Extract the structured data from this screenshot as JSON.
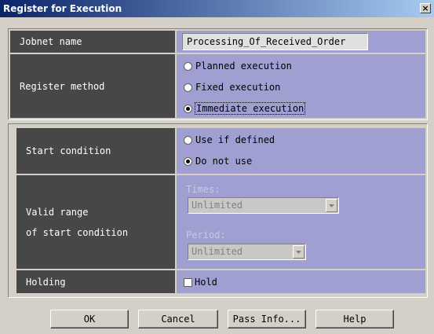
{
  "window": {
    "title": "Register for Execution",
    "close_glyph": "×"
  },
  "jobnet": {
    "label": "Jobnet name",
    "value": "Processing_Of_Received_Order"
  },
  "register_method": {
    "label": "Register method",
    "options": [
      "Planned execution",
      "Fixed execution",
      "Immediate execution"
    ],
    "selected": "Immediate execution"
  },
  "start_condition": {
    "label": "Start condition",
    "options": [
      "Use if defined",
      "Do not use"
    ],
    "selected": "Do not use"
  },
  "valid_range": {
    "label": "Valid range\nof start condition",
    "times_label": "Times:",
    "times_value": "Unlimited",
    "period_label": "Period:",
    "period_value": "Unlimited"
  },
  "holding": {
    "label": "Holding",
    "checkbox_label": "Hold",
    "checked": false
  },
  "buttons": {
    "ok": "OK",
    "cancel": "Cancel",
    "pass_info": "Pass Info...",
    "help": "Help"
  },
  "colors": {
    "label_cell": "#474747",
    "value_cell": "#9f9fd1",
    "titlebar": "#0a246a"
  },
  "icons": {
    "radio": "radio-icon",
    "dropdown": "chevron-down-icon",
    "checkbox": "checkbox-icon"
  }
}
